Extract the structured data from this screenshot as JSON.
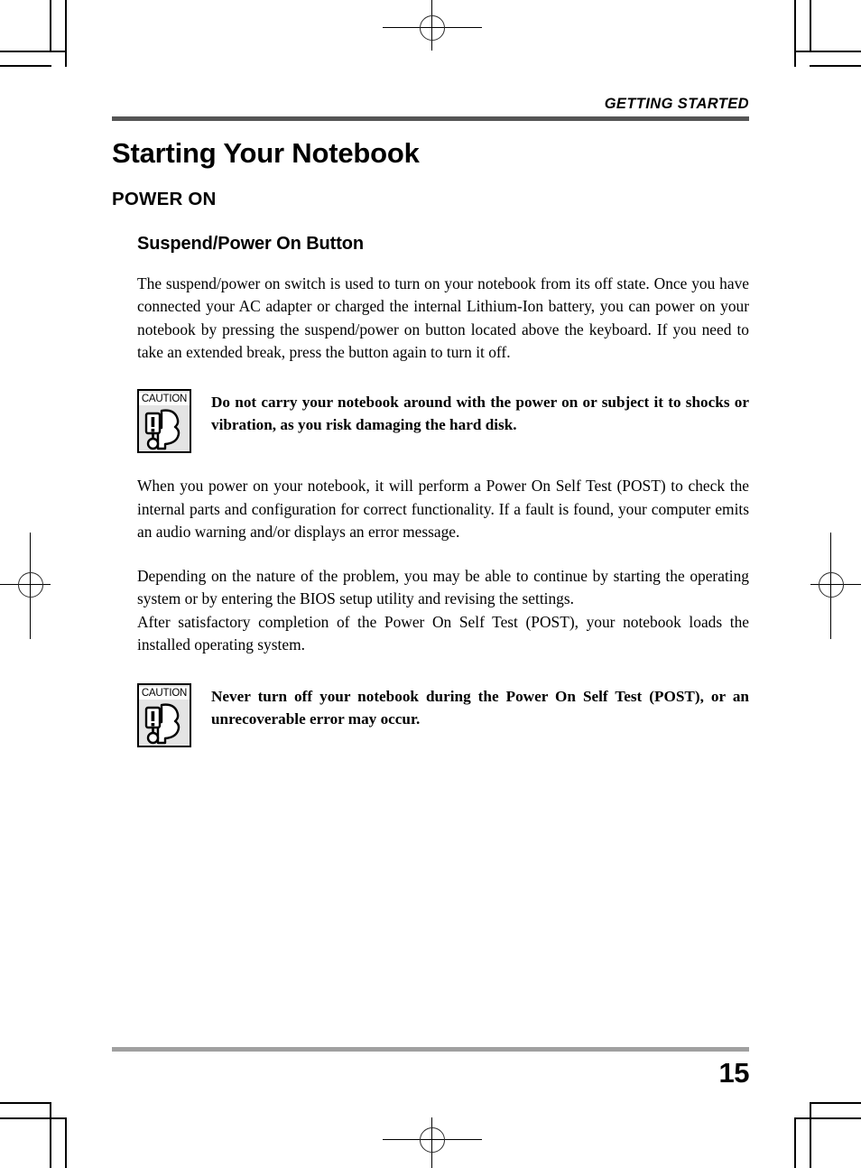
{
  "document": {
    "running_head": "GETTING STARTED",
    "chapter_title": "Starting Your Notebook",
    "section_title": "POWER ON",
    "subsection_title": "Suspend/Power On Button",
    "page_number": "15"
  },
  "colors": {
    "header_rule": "#555555",
    "footer_rule": "#a0a0a0",
    "caution_icon_background": "#e4e4e4",
    "text": "#000000"
  },
  "paragraphs": {
    "intro": "The suspend/power on switch is used to turn on your notebook from its off state. Once you have connected your AC adapter or charged the internal Lithium-Ion battery, you can power on your notebook by pressing the suspend/power on button located above the keyboard. If you need to take an extended break, press the button again to turn it off.",
    "post_check": "When you power on your notebook, it will perform a Power On Self Test (POST) to check the internal parts and configuration for correct functionality. If a fault is found, your computer emits an audio warning and/or displays an error message.",
    "problem_nature": "Depending on the nature of the problem, you may be able to continue by starting the operating system or by entering the BIOS setup utility and revising the settings.",
    "after_post": "After satisfactory completion of the Power On Self Test (POST), your notebook loads the installed operating system."
  },
  "cautions": [
    {
      "label": "CAUTION",
      "icon": "caution-hand-exclamation-icon",
      "text": "Do not carry your notebook around with the power on or subject it to shocks or vibration, as you risk damaging the hard disk."
    },
    {
      "label": "CAUTION",
      "icon": "caution-hand-exclamation-icon",
      "text": "Never turn off your notebook during the Power On Self Test (POST), or an unrecoverable error may occur."
    }
  ]
}
